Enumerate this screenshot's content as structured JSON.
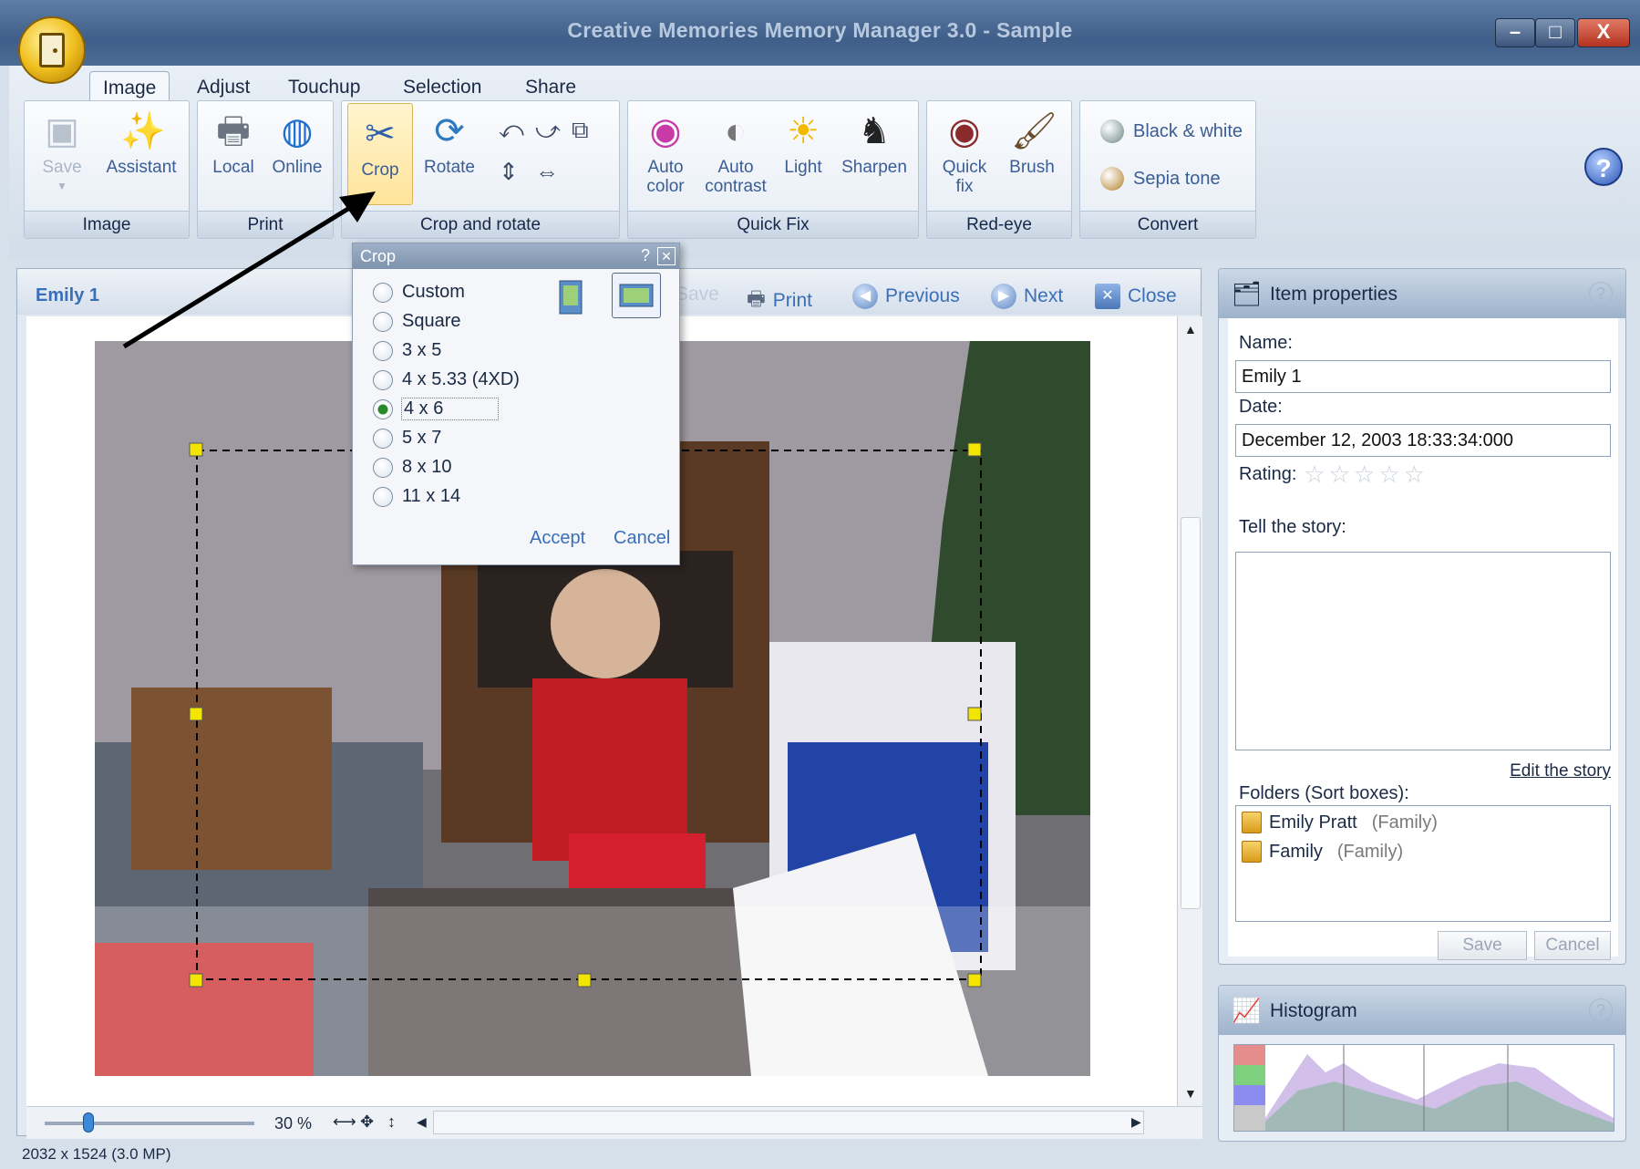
{
  "window": {
    "title": "Creative Memories Memory Manager 3.0 - Sample"
  },
  "tabs": [
    "Image",
    "Adjust",
    "Touchup",
    "Selection",
    "Share"
  ],
  "ribbon": {
    "groups": {
      "image": {
        "label": "Image",
        "save": "Save",
        "assistant": "Assistant"
      },
      "print": {
        "label": "Print",
        "local": "Local",
        "online": "Online"
      },
      "crop_rotate": {
        "label": "Crop and rotate",
        "crop": "Crop",
        "rotate": "Rotate"
      },
      "quick_fix": {
        "label": "Quick Fix",
        "auto_color": "Auto color",
        "auto_contrast": "Auto contrast",
        "light": "Light",
        "sharpen": "Sharpen"
      },
      "red_eye": {
        "label": "Red-eye",
        "quick_fix": "Quick fix",
        "brush": "Brush"
      },
      "convert": {
        "label": "Convert",
        "bw": "Black & white",
        "sepia": "Sepia tone"
      }
    },
    "help": "?"
  },
  "viewer": {
    "title": "Emily 1",
    "save": "Save",
    "print": "Print",
    "previous": "Previous",
    "next": "Next",
    "close": "Close",
    "zoom": "30 %"
  },
  "crop_dialog": {
    "title": "Crop",
    "options": [
      "Custom",
      "Square",
      "3 x 5",
      "4 x 5.33 (4XD)",
      "4 x 6",
      "5 x 7",
      "8 x 10",
      "11 x 14"
    ],
    "selected": "4 x 6",
    "accept": "Accept",
    "cancel": "Cancel"
  },
  "item_properties": {
    "title": "Item properties",
    "name_label": "Name:",
    "name_value": "Emily 1",
    "date_label": "Date:",
    "date_value": "December 12, 2003 18:33:34:000",
    "rating_label": "Rating:",
    "rating": 0,
    "story_label": "Tell the story:",
    "edit_story": "Edit the story",
    "folders_label": "Folders (Sort boxes):",
    "folders": [
      {
        "name": "Emily Pratt",
        "category": "(Family)"
      },
      {
        "name": "Family",
        "category": "(Family)"
      }
    ],
    "save": "Save",
    "cancel": "Cancel"
  },
  "histogram": {
    "title": "Histogram"
  },
  "status": "2032 x 1524 (3.0 MP)",
  "colors": {
    "accent": "#3a6fb8",
    "titlebar": "#4c6c96",
    "ribbon": "#d2dde9"
  }
}
